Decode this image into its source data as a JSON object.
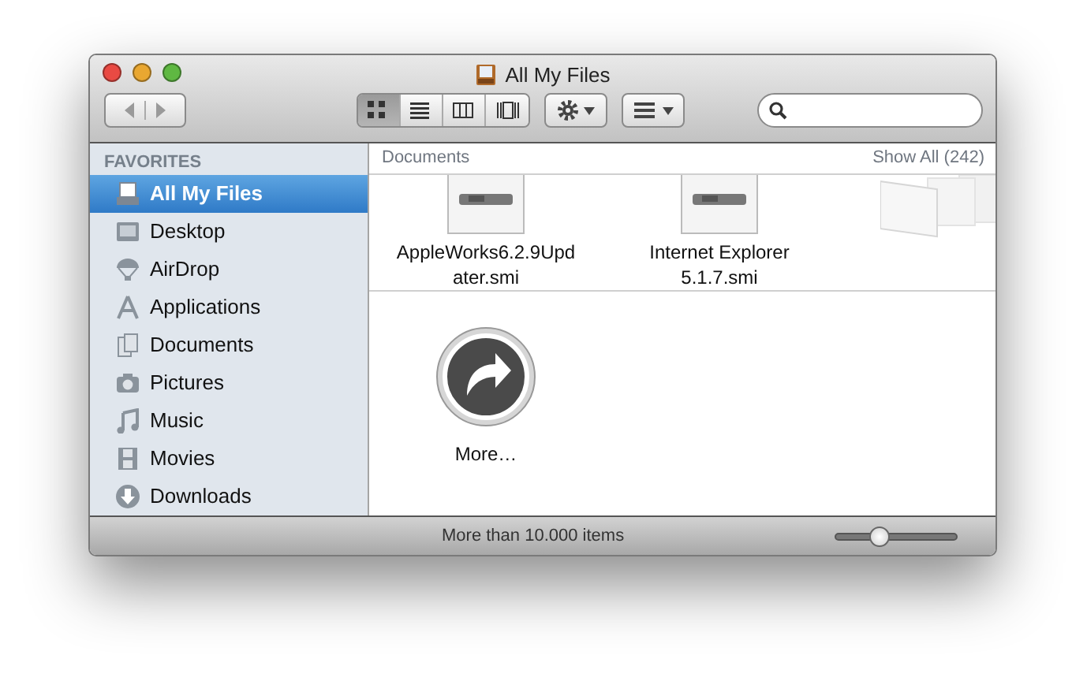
{
  "window": {
    "title": "All My Files"
  },
  "toolbar": {
    "view_buttons": [
      {
        "kind": "icon",
        "selected": true
      },
      {
        "kind": "list",
        "selected": false
      },
      {
        "kind": "columns",
        "selected": false
      },
      {
        "kind": "coverflow",
        "selected": false
      }
    ]
  },
  "sidebar": {
    "heading": "FAVORITES",
    "items": [
      {
        "label": "All My Files",
        "kind": "allfiles",
        "selected": true
      },
      {
        "label": "Desktop",
        "kind": "desktop",
        "selected": false
      },
      {
        "label": "AirDrop",
        "kind": "airdrop",
        "selected": false
      },
      {
        "label": "Applications",
        "kind": "apps",
        "selected": false
      },
      {
        "label": "Documents",
        "kind": "docs",
        "selected": false
      },
      {
        "label": "Pictures",
        "kind": "pictures",
        "selected": false
      },
      {
        "label": "Music",
        "kind": "music",
        "selected": false
      },
      {
        "label": "Movies",
        "kind": "movies",
        "selected": false
      },
      {
        "label": "Downloads",
        "kind": "downloads",
        "selected": false
      }
    ]
  },
  "content": {
    "section": {
      "title": "Documents",
      "show_all": "Show All (242)",
      "files": [
        {
          "name": "AppleWorks6.2.9Upd ater.smi",
          "kind": "disk"
        },
        {
          "name": "Internet Explorer 5.1.7.smi",
          "kind": "disk"
        },
        {
          "kind": "logs"
        }
      ]
    },
    "more": {
      "label": "More…"
    }
  },
  "status_bar": {
    "text": "More than 10.000 items",
    "zoom": {
      "level": 0.35
    }
  }
}
